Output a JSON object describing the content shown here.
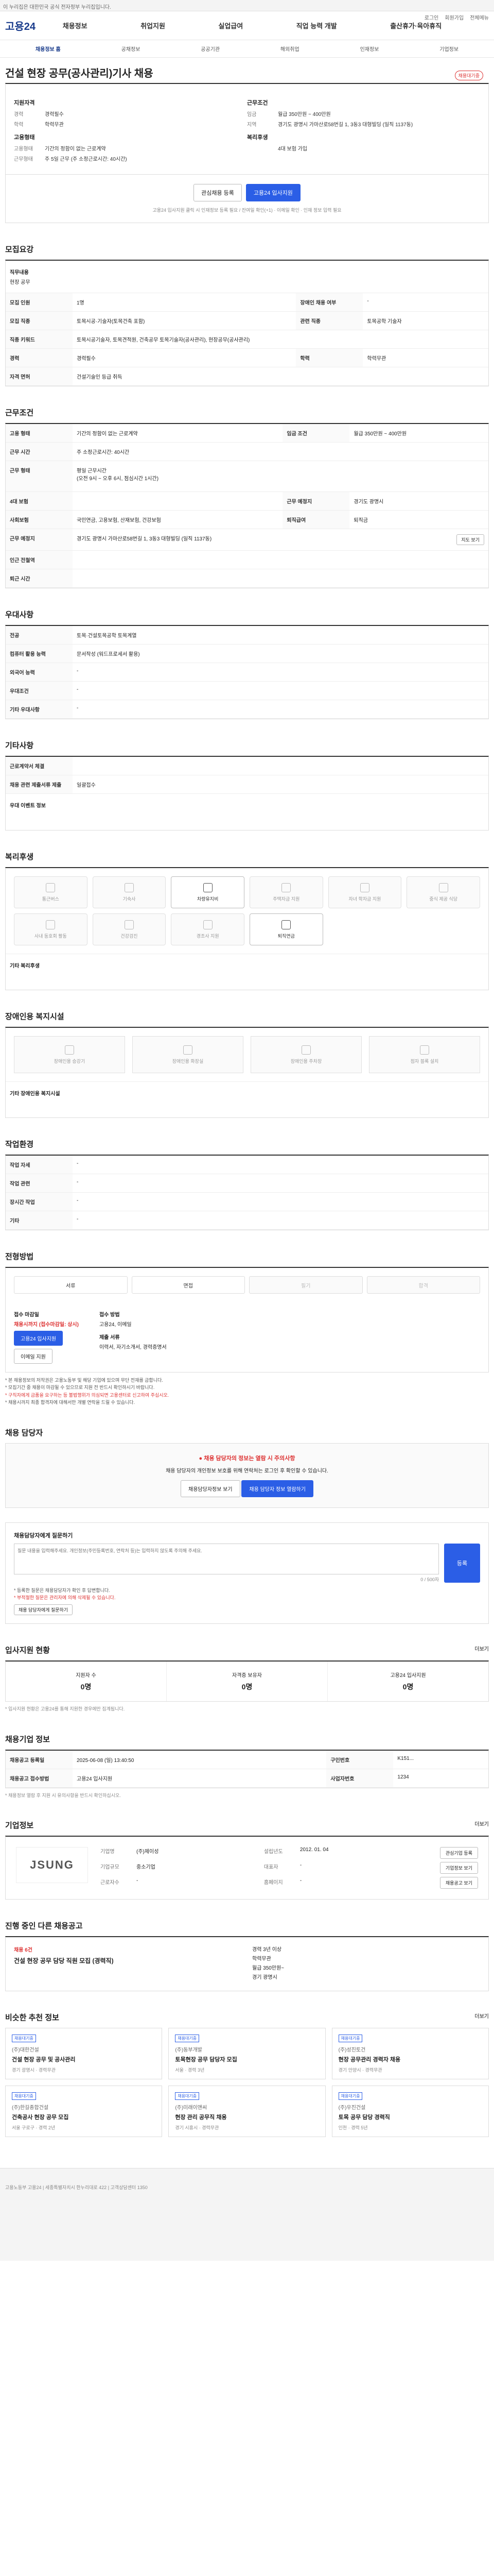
{
  "topbar": {
    "text": "이 누리집은 대한민국 공식 전자정부 누리집입니다."
  },
  "header": {
    "logo": "고용24",
    "gnb": [
      "채용정보",
      "취업지원",
      "실업급여",
      "직업 능력 개발",
      "출산휴가·육아휴직"
    ],
    "right": [
      "로그인",
      "회원가입",
      "전체메뉴"
    ]
  },
  "subnav": [
    "채용정보 홈",
    "공채정보",
    "공공기관",
    "해외취업",
    "인재정보",
    "기업정보"
  ],
  "posting": {
    "title": "건설 현장 공무(공사관리)기사 채용",
    "badge": "채용대기중",
    "left": {
      "group1": "지원자격",
      "rows1": [
        {
          "k": "경력",
          "v": "경력필수"
        },
        {
          "k": "학력",
          "v": "학력무관"
        }
      ],
      "group2": "고용형태",
      "rows2": [
        {
          "k": "고용형태",
          "v": "기간의 정함이 없는 근로계약"
        },
        {
          "k": "근무형태",
          "v": "주 5일 근무 (주 소정근로시간: 40시간)"
        }
      ]
    },
    "right": {
      "group1": "근무조건",
      "rows1": [
        {
          "k": "임금",
          "v": "월급 350만원 ~ 400만원"
        },
        {
          "k": "지역",
          "v": "경기도 광명시 가마산로58번길 1, 3동3 대형빌딩 (일직 1137동)"
        }
      ],
      "group2": "복리후생",
      "rows2": [
        {
          "k": "",
          "v": "4대 보험 가입"
        }
      ]
    },
    "buttons": {
      "save": "관심채용 등록",
      "apply": "고용24 입사지원"
    },
    "note": "고용24 입사지원 클릭 시 인재정보 등록 필요 / 잔여일 확인(+1) · 이메일 확인 · 인재 정보 입력 필요"
  },
  "recruit": {
    "title": "모집요강",
    "job_title_label": "직무내용",
    "job_title_value": "현장 공무",
    "rows": [
      {
        "k1": "모집 인원",
        "v1": "1명",
        "k2": "장애인 채용 여부",
        "v2": "-"
      },
      {
        "k1": "모집 직종",
        "v1": "토목시공·기술자(토목건축 포함)",
        "k2": "관련 직종",
        "v2": "토목공학 기술자"
      },
      {
        "k1": "직종 키워드",
        "v1": "토목시공기술자, 토목견적원, 건축공무 토목기술자(공사관리), 현장공무(공사관리)",
        "k2": "",
        "v2": ""
      },
      {
        "k1": "경력",
        "v1": "경력필수",
        "k2": "학력",
        "v2": "학력무관"
      },
      {
        "k1": "자격 면허",
        "v1": "건설기술인 등급 취득",
        "k2": "",
        "v2": ""
      }
    ]
  },
  "conditions": {
    "title": "근무조건",
    "rows": [
      {
        "k": "고용 형태",
        "v": "기간의 정함이 없는 근로계약",
        "k2": "임금 조건",
        "v2": "월급 350만원 ~ 400만원"
      },
      {
        "k": "근무 시간",
        "v": "주 소정근로시간: 40시간",
        "k2": "",
        "v2": ""
      },
      {
        "k": "근무 형태",
        "v": "평일 근무시간\n(오전 9시 ~ 오후 6시, 점심시간 1시간)",
        "k2": "",
        "v2": ""
      },
      {
        "k": "4대 보험",
        "v": "",
        "k2": "근무 예정지",
        "v2": "경기도 광명시"
      },
      {
        "k": "사회보험",
        "v": "국민연금, 고용보험, 산재보험, 건강보험",
        "k2": "퇴직급여",
        "v2": "퇴직금"
      },
      {
        "k": "근무 예정지",
        "v": "경기도 광명시 가마산로58번길 1, 3동3 대형빌딩 (일직 1137동)",
        "k2": "",
        "v2": ""
      },
      {
        "k": "인근 전철역",
        "v": "",
        "k2": "",
        "v2": ""
      },
      {
        "k": "퇴근 시간",
        "v": "",
        "k2": "",
        "v2": ""
      }
    ],
    "map_btn": "지도 보기"
  },
  "preference": {
    "title": "우대사항",
    "rows": [
      {
        "k": "전공",
        "v": "토목·건설토목공학 토목계열"
      },
      {
        "k": "컴퓨터 활용 능력",
        "v": "문서작성 (워드프로세서 활용)"
      },
      {
        "k": "외국어 능력",
        "v": "-"
      },
      {
        "k": "우대조건",
        "v": "-"
      },
      {
        "k": "기타 우대사항",
        "v": "-"
      }
    ]
  },
  "etc": {
    "title": "기타사항",
    "rows": [
      {
        "k": "근로계약서 체결",
        "v": ""
      },
      {
        "k": "채용 관련 제출서류 제출",
        "v": "일괄접수"
      }
    ],
    "sub": "우대 이벤트 정보"
  },
  "welfare": {
    "title": "복리후생",
    "items": [
      "통근버스",
      "기숙사",
      "차량유지비",
      "주택자금 지원",
      "자녀 학자금 지원",
      "중식 제공 식당",
      "사내 동호회 활동",
      "건강검진",
      "경조사 지원",
      "퇴직연금"
    ],
    "extra_label": "기타 복리후생"
  },
  "disability": {
    "title": "장애인용 복지시설",
    "items": [
      "장애인용 승강기",
      "장애인용 화장실",
      "장애인용 주차장",
      "점자 블록 설치"
    ],
    "extra_label": "기타 장애인용 복지시설"
  },
  "workplace": {
    "title": "작업환경",
    "rows": [
      {
        "k": "작업 자세",
        "v": "-",
        "k2": "",
        "v2": ""
      },
      {
        "k": "작업 관련",
        "v": "-",
        "k2": "",
        "v2": ""
      },
      {
        "k": "장시간 작업",
        "v": "-",
        "k2": "",
        "v2": ""
      },
      {
        "k": "기타",
        "v": "-",
        "k2": "",
        "v2": ""
      }
    ]
  },
  "process": {
    "title": "전형방법",
    "steps": [
      "서류",
      "면접",
      "필기",
      "합격"
    ],
    "deadline_k": "접수 마감일",
    "deadline_v": "채용시까지 (접수마감일: 상시)",
    "apply_k": "접수 방법",
    "apply_v": "고용24, 이메일",
    "apply_btn": "고용24 입사지원",
    "email_btn": "이메일 지원",
    "docs_k": "제출 서류",
    "docs_v": "이력서, 자기소개서, 경력증명서",
    "warnings": [
      "* 본 채용정보의 저작권은 고용노동부 및 해당 기업에 있으며 무단 전재를 금합니다.",
      "* 모집기간 중 채용이 마감될 수 있으므로 지원 전 반드시 확인하시기 바랍니다.",
      "* 구직자에게 금품을 요구하는 등 불법행위가 의심되면 고용센터로 신고하여 주십시오.",
      "* 채용시까지 최종 합격자에 대해서만 개별 연락을 드릴 수 있습니다."
    ]
  },
  "contact": {
    "title": "채용 담당자",
    "alert": "채용 담당자의 정보는 열람 시 주의사항",
    "desc": "채용 담당자의 개인정보 보호를 위해 연락처는 로그인 후 확인할 수 있습니다.",
    "btn1": "채용담당자정보 보기",
    "btn2": "채용 담당자 정보 열람하기"
  },
  "qna": {
    "title": "채용담당자에게 질문하기",
    "placeholder": "질문 내용을 입력해주세요. 개인정보(주민등록번호, 연락처 등)는 입력하지 않도록 주의해 주세요.",
    "count": "0 / 500자",
    "btn": "등록",
    "notes": [
      "* 등록한 질문은 채용담당자가 확인 후 답변합니다.",
      "* 부적절한 질문은 관리자에 의해 삭제될 수 있습니다."
    ],
    "link": "채용 담당자에게 질문하기"
  },
  "status": {
    "title": "입사지원 현황",
    "more": "더보기",
    "cells": [
      {
        "k": "지원자 수",
        "v": "0명"
      },
      {
        "k": "자격증 보유자",
        "v": "0명"
      },
      {
        "k": "고용24 입사지원",
        "v": "0명"
      }
    ],
    "note": "* 입사지원 현황은 고용24를 통해 지원한 경우에만 집계됩니다."
  },
  "posting_info": {
    "title": "채용기업 정보",
    "rows": [
      {
        "k": "채용공고 등록일",
        "v": "2025-06-08 (일) 13:40:50",
        "k2": "구인번호",
        "v2": "K151..."
      },
      {
        "k": "채용공고 접수방법",
        "v": "고용24 입사지원",
        "k2": "사업자번호",
        "v2": "1234"
      }
    ],
    "note": "* 채용정보 열람 후 지원 시 유의사항을 반드시 확인하십시오."
  },
  "company": {
    "title": "기업정보",
    "logo": "JSUNG",
    "name_k": "기업명",
    "name_v": "(주)제이성",
    "size_k": "기업규모",
    "size_v": "중소기업",
    "ceo_k": "대표자",
    "ceo_v": "-",
    "emp_k": "근로자수",
    "emp_v": "-",
    "found_k": "설립년도",
    "found_v": "2012. 01. 04",
    "homepage_k": "홈페이지",
    "homepage_v": "-",
    "btns": [
      "관심기업 등록",
      "기업정보 보기",
      "채용공고 보기"
    ],
    "more": "더보기"
  },
  "other": {
    "title": "진행 중인 다른 채용공고",
    "card_tag": "채용 6건",
    "card_title": "건설 현장 공무 담당 직원 모집 (경력직)",
    "card_items": [
      "경력 3년 이상",
      "학력무관",
      "월급 350만원~",
      "경기 광명시"
    ]
  },
  "recommend": {
    "title": "비슷한 추천 정보",
    "more": "더보기",
    "cards": [
      {
        "tag": "채용대기중",
        "co": "(주)대한건설",
        "tt": "건설 현장 공무 및 공사관리",
        "meta": "경기 광명시 · 경력무관"
      },
      {
        "tag": "채용대기중",
        "co": "(주)동부개발",
        "tt": "토목현장 공무 담당자 모집",
        "meta": "서울 · 경력 3년"
      },
      {
        "tag": "채용대기중",
        "co": "(주)성진토건",
        "tt": "현장 공무관리 경력자 채용",
        "meta": "경기 안양시 · 경력무관"
      },
      {
        "tag": "채용대기중",
        "co": "(주)한길종합건설",
        "tt": "건축공사 현장 공무 모집",
        "meta": "서울 구로구 · 경력 2년"
      },
      {
        "tag": "채용대기중",
        "co": "(주)미래이앤씨",
        "tt": "현장 관리 공무직 채용",
        "meta": "경기 시흥시 · 경력무관"
      },
      {
        "tag": "채용대기중",
        "co": "(주)우진건설",
        "tt": "토목 공무 담당 경력직",
        "meta": "인천 · 경력 5년"
      }
    ]
  },
  "footer": {
    "text": "고용노동부 고용24 | 세종특별자치시 한누리대로 422 | 고객상담센터 1350"
  }
}
